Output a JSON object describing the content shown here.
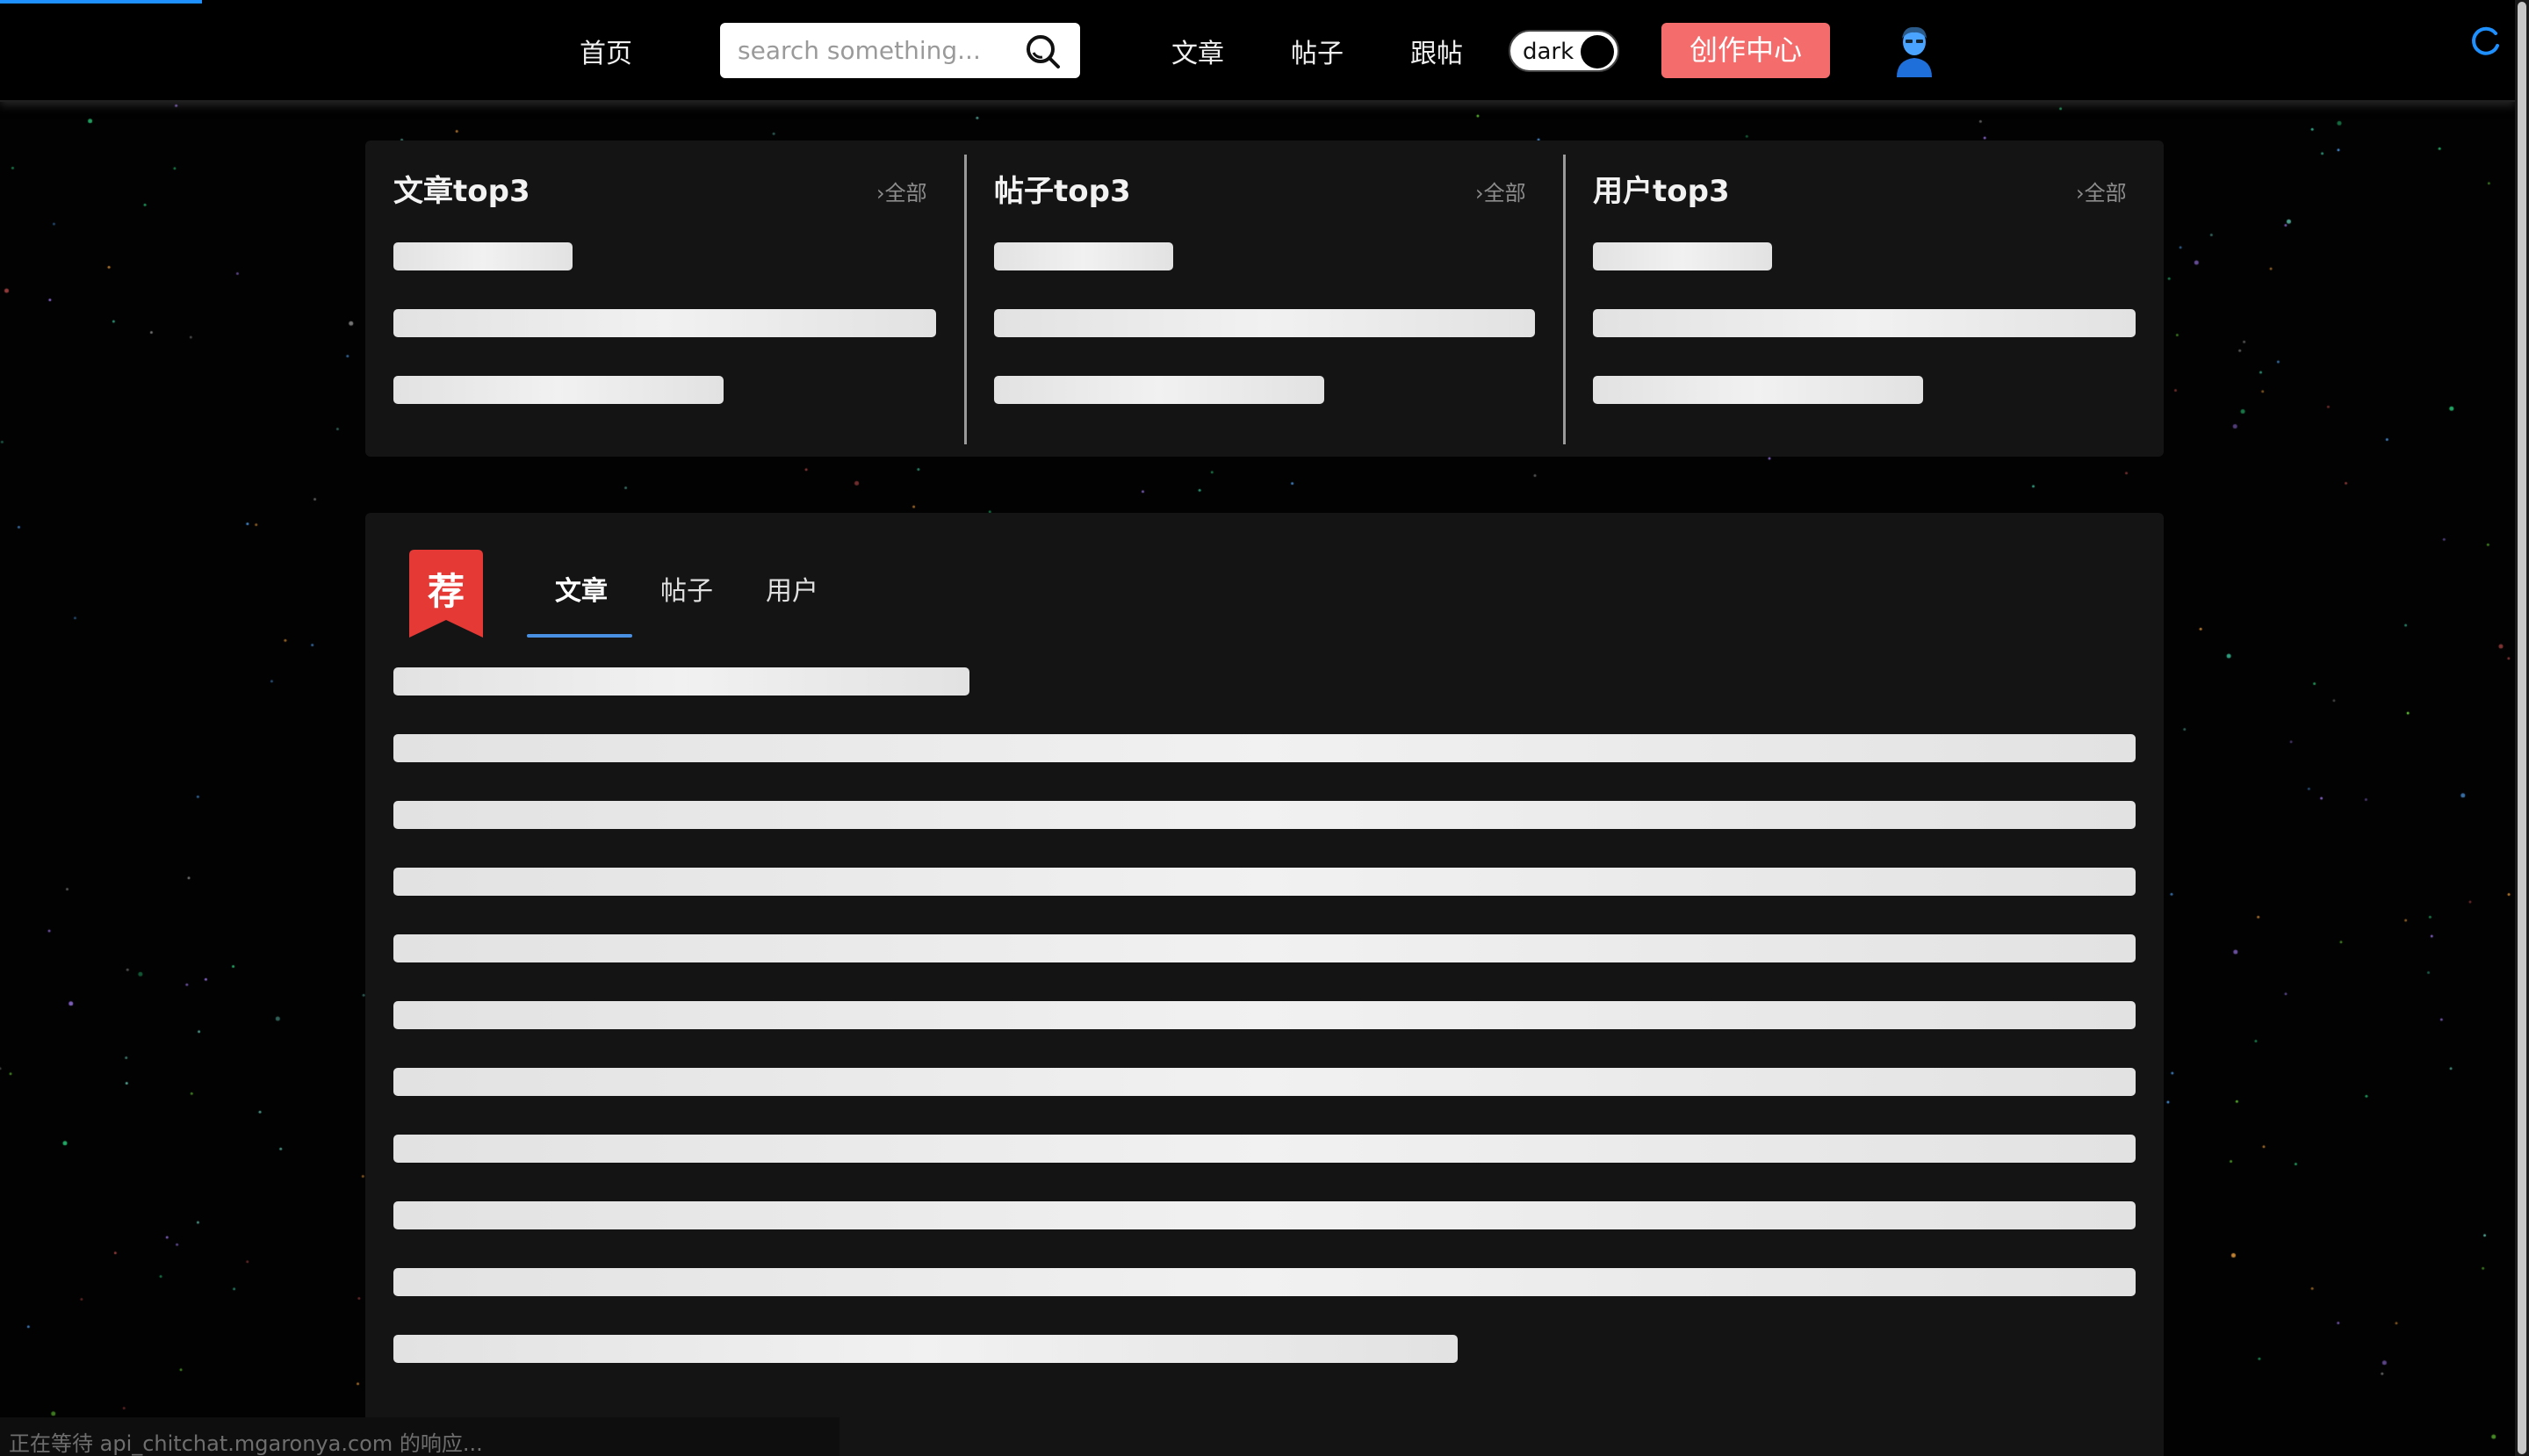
{
  "header": {
    "home_label": "首页",
    "search_placeholder": "search something...",
    "nav": [
      "文章",
      "帖子",
      "跟帖"
    ],
    "theme_toggle_label": "dark",
    "create_button_label": "创作中心"
  },
  "top3": {
    "columns": [
      {
        "title": "文章top3",
        "more": "全部"
      },
      {
        "title": "帖子top3",
        "more": "全部"
      },
      {
        "title": "用户top3",
        "more": "全部"
      }
    ]
  },
  "recommend": {
    "badge": "荐",
    "tabs": [
      "文章",
      "帖子",
      "用户"
    ],
    "active_tab": "文章"
  },
  "status_bar": "正在等待 api_chitchat.mgaronya.com 的响应...",
  "colors": {
    "background": "#020202",
    "panel": "#141415",
    "accent_red": "#f56c6c",
    "badge_red": "#e53935",
    "tab_underline": "#4a90e2",
    "loading_blue": "#1e90ff"
  },
  "icons": [
    "search-icon",
    "avatar-icon",
    "loading-spinner-icon",
    "chevron-right-icon"
  ]
}
